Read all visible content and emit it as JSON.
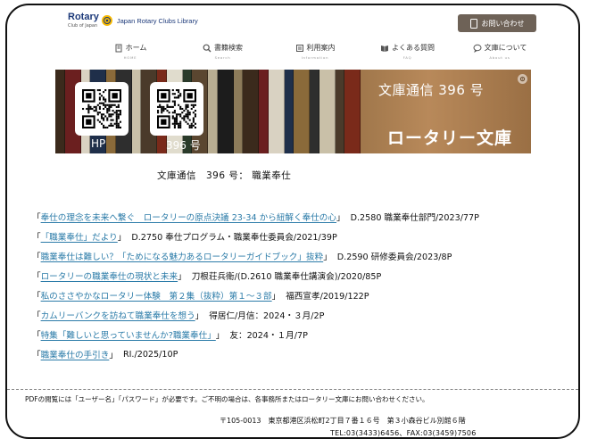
{
  "header": {
    "logo_name": "Rotary",
    "logo_sub": "Club of Japan",
    "logo_jp": "Japan Rotary Clubs Library",
    "contact_label": "お問い合わせ"
  },
  "nav": [
    {
      "label": "ホーム",
      "sub": "HOME"
    },
    {
      "label": "書籍検索",
      "sub": "Search"
    },
    {
      "label": "利用案内",
      "sub": "Information"
    },
    {
      "label": "よくある質問",
      "sub": "FAQ"
    },
    {
      "label": "文庫について",
      "sub": "About us"
    }
  ],
  "banner": {
    "issue": "文庫通信 396 号",
    "brand": "ロータリー文庫",
    "qr_hp": "HP",
    "qr_issue": "396 号"
  },
  "title": "文庫通信　396 号：  職業奉仕",
  "links": [
    {
      "text": "奉仕の理念を未来へ繋ぐ　ロータリーの原点決議 23-34 から紐解く奉仕の心",
      "ref": "D.2580 職業奉仕部門/2023/77P"
    },
    {
      "text": "「職業奉仕」だより",
      "ref": "D.2750 奉仕プログラム・職業奉仕委員会/2021/39P"
    },
    {
      "text": "職業奉仕は難しい？「ためになる魅力あるロータリーガイドブック」抜粋",
      "ref": "D.2590 研修委員会/2023/8P"
    },
    {
      "text": "ロータリーの職業奉仕の現状と未来",
      "ref": "刀根荘兵衛/(D.2610 職業奉仕講演会)/2020/85P"
    },
    {
      "text": "私のささやかなロータリー体験　第２集（抜粋）第１～３部",
      "ref": "福西宣孝/2019/122P"
    },
    {
      "text": "カムリーバンクを訪ねて職業奉仕を想う",
      "ref": "得居仁/月信：2024・３月/2P"
    },
    {
      "text": "特集「難しいと思っていませんか?職業奉仕」",
      "ref": "友：2024・１月/7P"
    },
    {
      "text": "職業奉仕の手引き",
      "ref": "RI./2025/10P"
    }
  ],
  "footer": {
    "notice": "PDFの閲覧には「ユーザー名」「パスワード」が必要です。ご不明の場合は、各事務所またはロータリー文庫にお問い合わせください。",
    "address": "〒105-0013　東京都港区浜松町2丁目７番１６号　第３小森谷ビル別館６階",
    "tel": "TEL:03(3433)6456、FAX:03(3459)7506"
  },
  "colors": {
    "link": "#2b7ba8",
    "contact_bg": "#6e6257",
    "logo_blue": "#1d3a7a"
  }
}
